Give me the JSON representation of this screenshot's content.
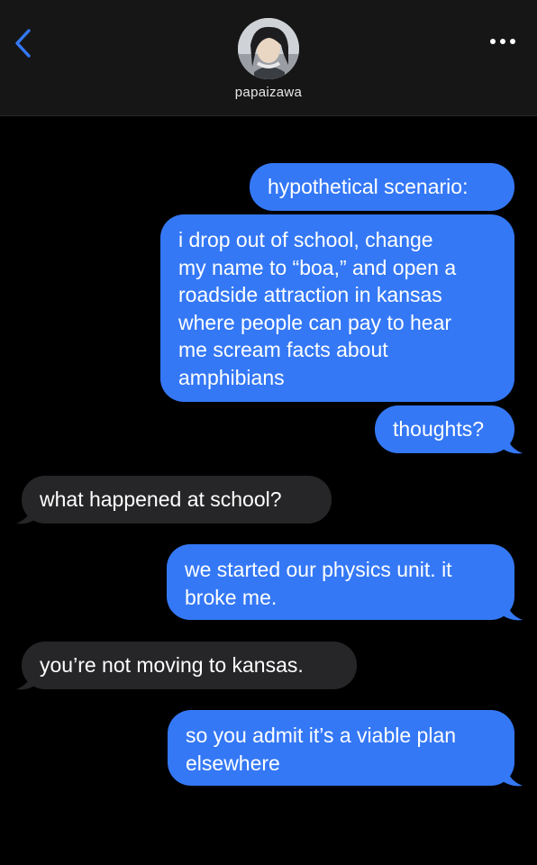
{
  "header": {
    "contact_name": "papaizawa",
    "back_icon": "chevron-left-icon",
    "more_icon": "more-dots-icon",
    "accent_color": "#3478f6"
  },
  "messages": [
    {
      "from": "me",
      "text": "hypothetical scenario:"
    },
    {
      "from": "me",
      "text": "i drop out of school, change\nmy name to “boa,” and open a\nroadside attraction in kansas\nwhere people can pay to hear\nme scream facts about\namphibians"
    },
    {
      "from": "me",
      "text": "thoughts?"
    },
    {
      "from": "them",
      "text": "what happened at school?"
    },
    {
      "from": "me",
      "text": "we started our physics unit. it\nbroke me."
    },
    {
      "from": "them",
      "text": "you’re not moving to kansas."
    },
    {
      "from": "me",
      "text": "so you admit it’s a viable plan\nelsewhere"
    }
  ],
  "colors": {
    "sent_bubble": "#3478f6",
    "received_bubble": "#262628",
    "background": "#000000",
    "header_bg": "#161616"
  }
}
